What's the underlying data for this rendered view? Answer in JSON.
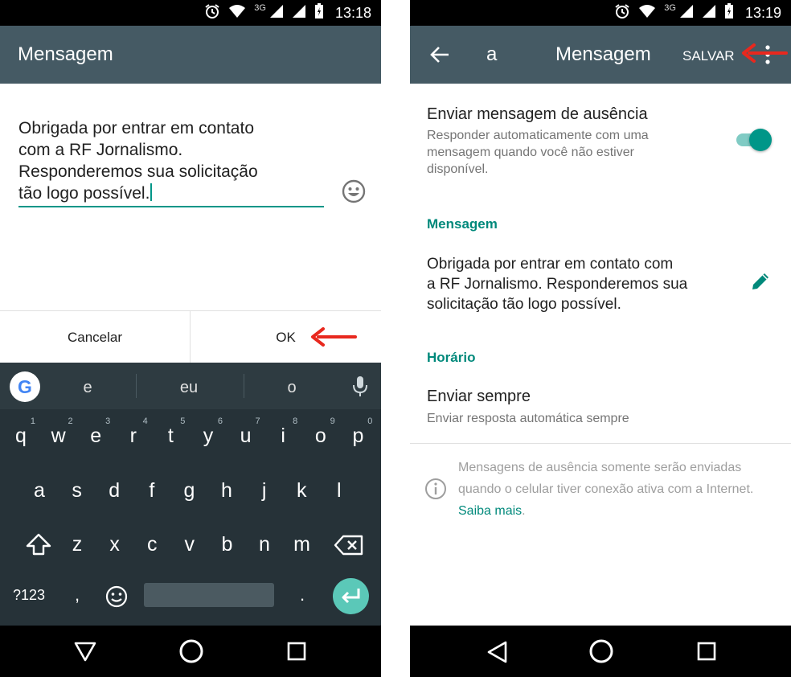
{
  "left_screen": {
    "status_bar": {
      "network": "3G",
      "time": "13:18"
    },
    "app_bar": {
      "title": "Mensagem"
    },
    "dialog": {
      "message": "Obrigada por entrar em contato\ncom a RF Jornalismo.\nResponderemos sua solicitação\ntão logo possível.",
      "cancel_label": "Cancelar",
      "ok_label": "OK"
    },
    "keyboard": {
      "suggestions": [
        "e",
        "eu",
        "o"
      ],
      "row1": [
        "q",
        "w",
        "e",
        "r",
        "t",
        "y",
        "u",
        "i",
        "o",
        "p"
      ],
      "row1_hints": [
        "1",
        "2",
        "3",
        "4",
        "5",
        "6",
        "7",
        "8",
        "9",
        "0"
      ],
      "row2": [
        "a",
        "s",
        "d",
        "f",
        "g",
        "h",
        "j",
        "k",
        "l"
      ],
      "row3": [
        "z",
        "x",
        "c",
        "v",
        "b",
        "n",
        "m"
      ],
      "symbols_label": "?123",
      "comma": ",",
      "period": "."
    }
  },
  "right_screen": {
    "status_bar": {
      "network": "3G",
      "time": "13:19"
    },
    "app_bar": {
      "contact": "a",
      "title": "Mensagem",
      "save_label": "SALVAR"
    },
    "away_setting": {
      "title": "Enviar mensagem de ausência",
      "subtitle": "Responder automaticamente com uma\nmensagem quando você não estiver\ndisponível.",
      "enabled": true
    },
    "message_section": {
      "header": "Mensagem",
      "text": "Obrigada por entrar em contato com\na RF Jornalismo. Responderemos sua\nsolicitação tão logo possível."
    },
    "schedule_section": {
      "header": "Horário",
      "title": "Enviar sempre",
      "subtitle": "Enviar resposta automática sempre"
    },
    "info": {
      "text": "Mensagens de ausência somente serão enviadas quando o celular tiver conexão ativa com a Internet.",
      "link": "Saiba mais",
      "suffix": "."
    }
  },
  "colors": {
    "app_bar": "#455a64",
    "accent": "#009688",
    "keyboard": "#263238",
    "annotation_arrow": "#e8281e"
  },
  "icons": [
    "alarm-icon",
    "wifi-icon",
    "signal-icon",
    "battery-icon",
    "emoji-icon",
    "google-icon",
    "mic-icon",
    "shift-icon",
    "backspace-icon",
    "enter-icon",
    "back-arrow-icon",
    "more-vert-icon",
    "edit-icon",
    "info-icon",
    "nav-back-icon",
    "nav-home-icon",
    "nav-recents-icon"
  ]
}
